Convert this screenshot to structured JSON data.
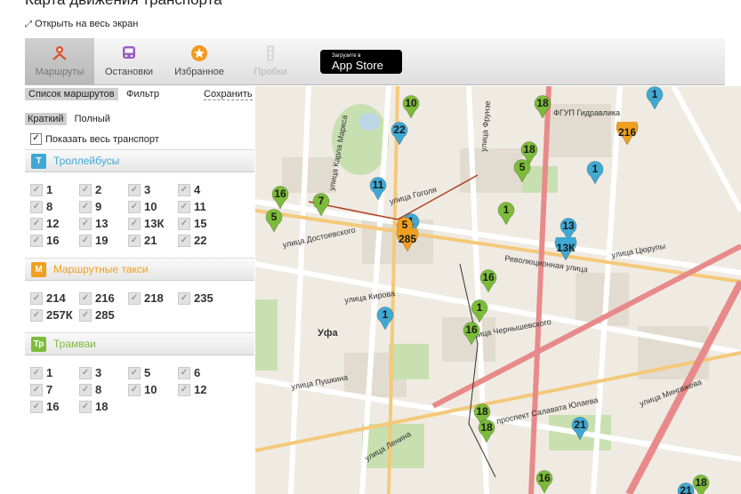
{
  "header": {
    "title": "Карта движения транспорта",
    "fullscreen": "Открыть на весь экран"
  },
  "toolbar": {
    "routes": "Маршруты",
    "stops": "Остановки",
    "favorites": "Избранное",
    "traffic": "Пробки",
    "appstore_small": "Загрузите в",
    "appstore_big": "App Store"
  },
  "subtabs": {
    "list": "Список маршрутов",
    "filter": "Фильтр",
    "save": "Сохранить"
  },
  "mode": {
    "short": "Краткий",
    "full": "Полный"
  },
  "show_all": "Показать весь транспорт",
  "categories": [
    {
      "badge": "Т",
      "name": "Троллейбусы",
      "color": "#3fa9d4",
      "routes": [
        "1",
        "2",
        "3",
        "4",
        "8",
        "9",
        "10",
        "11",
        "12",
        "13",
        "13К",
        "15",
        "16",
        "19",
        "21",
        "22"
      ]
    },
    {
      "badge": "М",
      "name": "Маршрутные такси",
      "color": "#f0a020",
      "routes": [
        "214",
        "216",
        "218",
        "235",
        "257К",
        "285"
      ]
    },
    {
      "badge": "Тр",
      "name": "Трамваи",
      "color": "#7cbc3a",
      "routes": [
        "1",
        "3",
        "5",
        "6",
        "7",
        "8",
        "10",
        "12",
        "16",
        "18"
      ]
    }
  ],
  "map": {
    "city": "Уфа",
    "streets": [
      "улица Достоевского",
      "улица Кирова",
      "улица Чернышевского",
      "улица Пушкина",
      "Революционная улица",
      "улица Гоголя",
      "улица Ленина",
      "проспект Салавата Юлаева",
      "улица Мингажева",
      "улица Карла Маркса",
      "улица Фрунзе",
      "улица Цюрупы"
    ],
    "labels": [
      "ФГУП Гидравлика"
    ],
    "markers": [
      {
        "n": "10",
        "t": "tram"
      },
      {
        "n": "18",
        "t": "tram"
      },
      {
        "n": "1",
        "t": "trolley"
      },
      {
        "n": "22",
        "t": "trolley"
      },
      {
        "n": "216",
        "t": "taxi"
      },
      {
        "n": "18",
        "t": "tram"
      },
      {
        "n": "5",
        "t": "tram"
      },
      {
        "n": "1",
        "t": "trolley"
      },
      {
        "n": "11",
        "t": "trolley"
      },
      {
        "n": "16",
        "t": "tram"
      },
      {
        "n": "7",
        "t": "tram"
      },
      {
        "n": "5",
        "t": "tram"
      },
      {
        "n": "1",
        "t": "trolley"
      },
      {
        "n": "5",
        "t": "taxi"
      },
      {
        "n": "285",
        "t": "taxi"
      },
      {
        "n": "1",
        "t": "tram"
      },
      {
        "n": "13",
        "t": "trolley"
      },
      {
        "n": "13К",
        "t": "trolley"
      },
      {
        "n": "16",
        "t": "tram"
      },
      {
        "n": "1",
        "t": "trolley"
      },
      {
        "n": "1",
        "t": "tram"
      },
      {
        "n": "16",
        "t": "tram"
      },
      {
        "n": "18",
        "t": "tram"
      },
      {
        "n": "18",
        "t": "tram"
      },
      {
        "n": "21",
        "t": "trolley"
      },
      {
        "n": "16",
        "t": "tram"
      },
      {
        "n": "18",
        "t": "tram"
      },
      {
        "n": "21",
        "t": "trolley"
      }
    ]
  },
  "colors": {
    "trolley": "#3fa9d4",
    "taxi": "#f0a020",
    "tram": "#7cbc3a"
  }
}
